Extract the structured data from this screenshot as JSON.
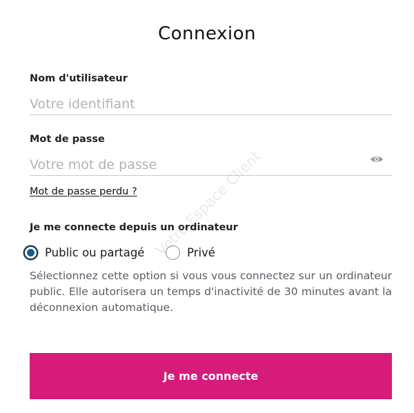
{
  "form": {
    "title": "Connexion",
    "username": {
      "label": "Nom d'utilisateur",
      "placeholder": "Votre identifiant",
      "value": ""
    },
    "password": {
      "label": "Mot de passe",
      "placeholder": "Votre mot de passe",
      "value": "",
      "toggle_icon": "eye-icon"
    },
    "forgot_password": "Mot de passe perdu ?",
    "device": {
      "label": "Je me connecte depuis un ordinateur",
      "options": [
        {
          "label": "Public ou partagé",
          "selected": true
        },
        {
          "label": "Privé",
          "selected": false
        }
      ],
      "help": "Sélectionnez cette option si vous vous connectez sur un ordinateur public. Elle autorisera un temps d'inactivité de 30 minutes avant la déconnexion automatique."
    },
    "submit_label": "Je me connecte"
  },
  "watermark": "Votre Espace Client",
  "colors": {
    "accent": "#d61b7b",
    "radio_selected": "#0f5f86",
    "help_text": "#555d66",
    "placeholder": "#b3b3b3"
  }
}
